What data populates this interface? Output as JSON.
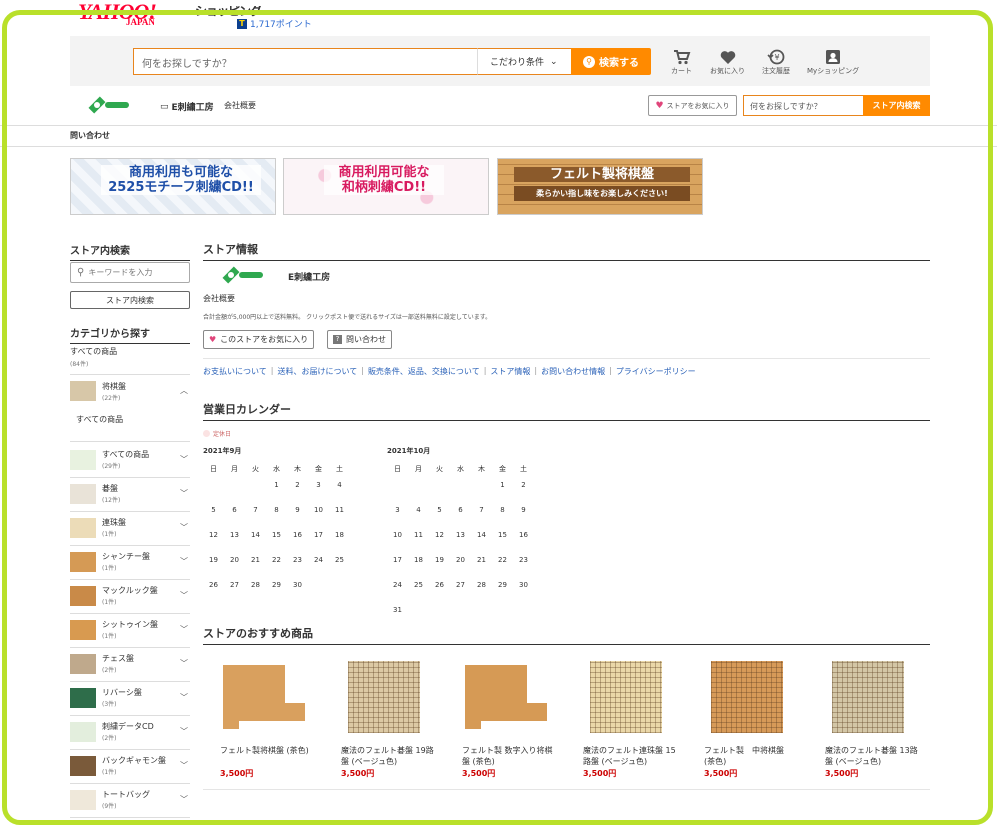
{
  "header": {
    "logo_text": "YAHOO!",
    "logo_japan": "JAPAN",
    "logo_shopping": "ショッピング",
    "points": "1,717ポイント",
    "search_placeholder": "何をお探しですか？",
    "condition_label": "こだわり条件",
    "search_button": "検索する",
    "icons": [
      {
        "name": "cart-icon",
        "label": "カート"
      },
      {
        "name": "heart-icon",
        "label": "お気に入り"
      },
      {
        "name": "history-icon",
        "label": "注文履歴"
      },
      {
        "name": "user-icon",
        "label": "Myショッピング"
      }
    ]
  },
  "store": {
    "name": "E刺繍工房",
    "about": "会社概要",
    "fav_button": "ストアをお気に入り",
    "search_placeholder": "何をお探しですか？",
    "search_button": "ストア内検索",
    "inquiry": "問い合わせ"
  },
  "banners": [
    {
      "line1": "商用利用も可能な",
      "line2": "2525モチーフ刺繍CD!!",
      "color": "#1e4fa8"
    },
    {
      "line1": "商用利用可能な",
      "line2": "和柄刺繍CD!!",
      "color": "#d81b60"
    },
    {
      "line1": "フェルト製将棋盤",
      "line2": "柔らかい指し味をお楽しみください!",
      "color": "#ffffff"
    }
  ],
  "sidebar": {
    "search_title": "ストア内検索",
    "search_placeholder": "キーワードを入力",
    "search_button": "ストア内検索",
    "category_title": "カテゴリから探す",
    "all_label": "すべての商品",
    "all_count": "(84件)",
    "shogi": {
      "name": "将棋盤",
      "count": "(22件)"
    },
    "shogi_all": "すべての商品",
    "categories": [
      {
        "name": "すべての商品",
        "count": "(29件)",
        "color": "#e8f2e0"
      },
      {
        "name": "碁盤",
        "count": "(12件)",
        "color": "#e9e3d8"
      },
      {
        "name": "連珠盤",
        "count": "(1件)",
        "color": "#ecdcb8"
      },
      {
        "name": "シャンチー盤",
        "count": "(1件)",
        "color": "#d59a55"
      },
      {
        "name": "マックルック盤",
        "count": "(1件)",
        "color": "#c98a48"
      },
      {
        "name": "シットゥイン盤",
        "count": "(1件)",
        "color": "#d89a50"
      },
      {
        "name": "チェス盤",
        "count": "(2件)",
        "color": "#bfa98c"
      },
      {
        "name": "リバーシ盤",
        "count": "(3件)",
        "color": "#2e6d4a"
      },
      {
        "name": "刺繍データCD",
        "count": "(2件)",
        "color": "#e3eedd"
      },
      {
        "name": "バックギャモン盤",
        "count": "(1件)",
        "color": "#7a5a3a"
      },
      {
        "name": "トートバッグ",
        "count": "(9件)",
        "color": "#efe8da"
      }
    ]
  },
  "info": {
    "title": "ストア情報",
    "store_name": "E刺繍工房",
    "about": "会社概要",
    "notice": "合計金額が5,000円以上で送料無料。 クリックポスト便で送れるサイズは一部送料無料に設定しています。",
    "fav_button": "このストアをお気に入り",
    "inquiry_button": "問い合わせ",
    "links": [
      "お支払いについて",
      "送料、お届けについて",
      "販売条件、返品、交換について",
      "ストア情報",
      "お問い合わせ情報",
      "プライバシーポリシー"
    ]
  },
  "calendar": {
    "title": "営業日カレンダー",
    "legend": "定休日",
    "weekdays": [
      "日",
      "月",
      "火",
      "水",
      "木",
      "金",
      "土"
    ],
    "months": [
      {
        "label": "2021年9月",
        "weeks": [
          [
            "",
            "",
            "",
            "1",
            "2",
            "3",
            "4"
          ],
          [
            "5",
            "6",
            "7",
            "8",
            "9",
            "10",
            "11"
          ],
          [
            "12",
            "13",
            "14",
            "15",
            "16",
            "17",
            "18"
          ],
          [
            "19",
            "20",
            "21",
            "22",
            "23",
            "24",
            "25"
          ],
          [
            "26",
            "27",
            "28",
            "29",
            "30",
            "",
            ""
          ]
        ]
      },
      {
        "label": "2021年10月",
        "weeks": [
          [
            "",
            "",
            "",
            "",
            "",
            "1",
            "2"
          ],
          [
            "3",
            "4",
            "5",
            "6",
            "7",
            "8",
            "9"
          ],
          [
            "10",
            "11",
            "12",
            "13",
            "14",
            "15",
            "16"
          ],
          [
            "17",
            "18",
            "19",
            "20",
            "21",
            "22",
            "23"
          ],
          [
            "24",
            "25",
            "26",
            "27",
            "28",
            "29",
            "30"
          ],
          [
            "31",
            "",
            "",
            "",
            "",
            "",
            ""
          ]
        ]
      }
    ]
  },
  "recommend": {
    "title": "ストアのおすすめ商品",
    "products": [
      {
        "name": "フェルト製将棋盤 (茶色)",
        "price": "3,500円",
        "color": "#d9a05e"
      },
      {
        "name": "魔法のフェルト碁盤 19路盤 (ベージュ色)",
        "price": "3,500円",
        "color": "#dcc9a4"
      },
      {
        "name": "フェルト製 数字入り将棋盤 (茶色)",
        "price": "3,500円",
        "color": "#d69a55"
      },
      {
        "name": "魔法のフェルト連珠盤 15路盤 (ベージュ色)",
        "price": "3,500円",
        "color": "#ead7a8"
      },
      {
        "name": "フェルト製　中将棋盤 (茶色)",
        "price": "3,500円",
        "color": "#d79a58"
      },
      {
        "name": "魔法のフェルト碁盤 13路盤 (ベージュ色)",
        "price": "3,500円",
        "color": "#d3c6a6"
      }
    ]
  }
}
